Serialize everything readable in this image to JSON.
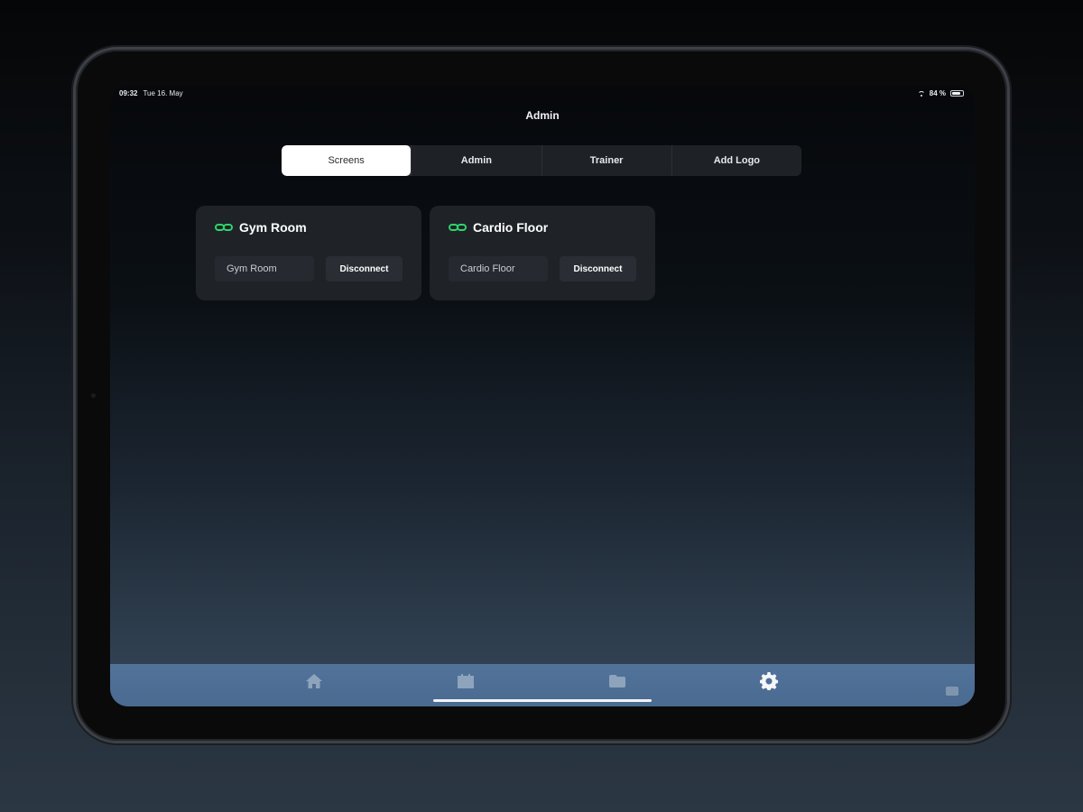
{
  "status_bar": {
    "time": "09:32",
    "date": "Tue 16. May",
    "battery": "84 %",
    "battery_level": 0.84
  },
  "header": {
    "title": "Admin"
  },
  "tabs": [
    {
      "label": "Screens",
      "active": true
    },
    {
      "label": "Admin",
      "active": false
    },
    {
      "label": "Trainer",
      "active": false
    },
    {
      "label": "Add Logo",
      "active": false
    }
  ],
  "screens": [
    {
      "title": "Gym Room",
      "field_value": "Gym Room",
      "button_label": "Disconnect",
      "status_color": "#2fd36a"
    },
    {
      "title": "Cardio Floor",
      "field_value": "Cardio Floor",
      "button_label": "Disconnect",
      "status_color": "#2fd36a"
    }
  ],
  "tab_bar": {
    "items": [
      {
        "icon": "home-icon",
        "active": false
      },
      {
        "icon": "calendar-icon",
        "active": false
      },
      {
        "icon": "folder-icon",
        "active": false
      },
      {
        "icon": "gear-icon",
        "active": true
      }
    ]
  },
  "colors": {
    "accent": "#2fd36a",
    "card_bg": "#1f2328",
    "tab_bar_bg": "#52739a",
    "active_tab_bg": "#ffffff"
  }
}
